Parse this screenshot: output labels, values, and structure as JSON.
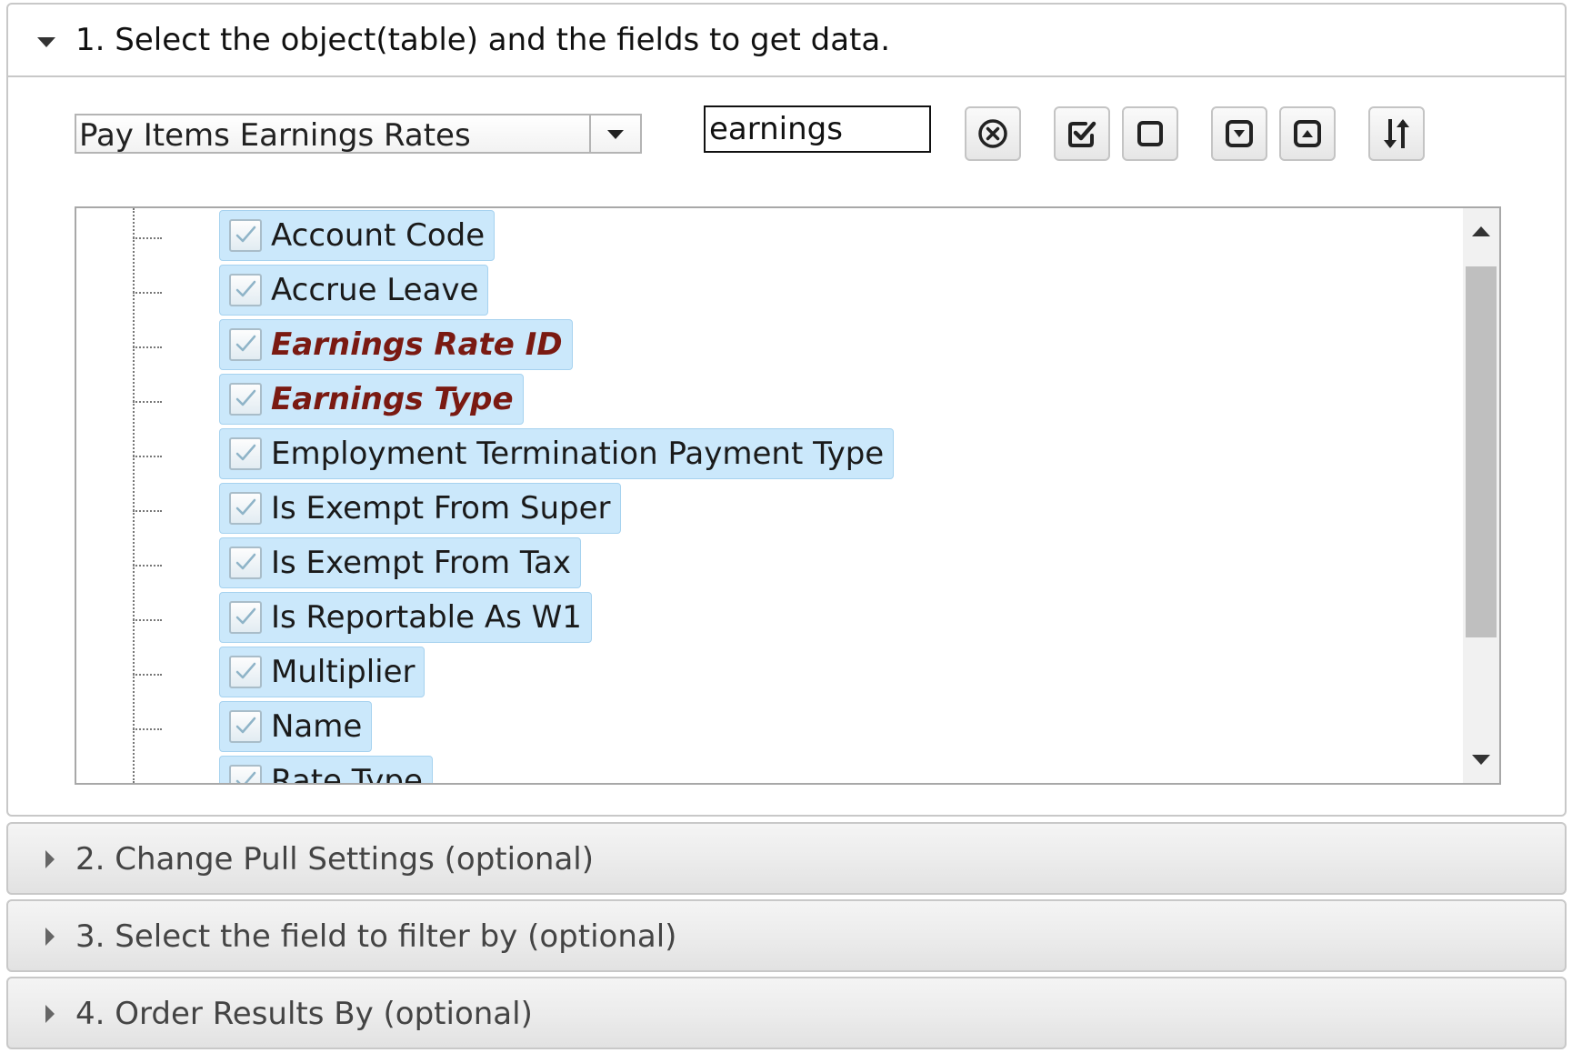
{
  "sections": [
    {
      "number": "1.",
      "title": "Select the object(table) and the fields to get data.",
      "expanded": true
    },
    {
      "number": "2.",
      "title": "Change Pull Settings (optional)",
      "expanded": false
    },
    {
      "number": "3.",
      "title": "Select the field to filter by (optional)",
      "expanded": false
    },
    {
      "number": "4.",
      "title": "Order Results By (optional)",
      "expanded": false
    }
  ],
  "object_select": {
    "value": "Pay Items Earnings Rates"
  },
  "search": {
    "value": "earnings",
    "placeholder": ""
  },
  "toolbar": [
    {
      "icon": "clear-circle-x-icon"
    },
    {
      "icon": "check-all-icon"
    },
    {
      "icon": "uncheck-all-icon"
    },
    {
      "icon": "expand-down-icon"
    },
    {
      "icon": "collapse-up-icon"
    },
    {
      "icon": "sort-icon"
    }
  ],
  "fields": [
    {
      "label": "Account Code",
      "checked": true,
      "key": false
    },
    {
      "label": "Accrue Leave",
      "checked": true,
      "key": false
    },
    {
      "label": "Earnings Rate ID",
      "checked": true,
      "key": true
    },
    {
      "label": "Earnings Type",
      "checked": true,
      "key": true
    },
    {
      "label": "Employment Termination Payment Type",
      "checked": true,
      "key": false
    },
    {
      "label": "Is Exempt From Super",
      "checked": true,
      "key": false
    },
    {
      "label": "Is Exempt From Tax",
      "checked": true,
      "key": false
    },
    {
      "label": "Is Reportable As W1",
      "checked": true,
      "key": false
    },
    {
      "label": "Multiplier",
      "checked": true,
      "key": false
    },
    {
      "label": "Name",
      "checked": true,
      "key": false
    },
    {
      "label": "Rate Type",
      "checked": true,
      "key": false
    }
  ],
  "colors": {
    "selected_bg": "#cbe8fb",
    "key_field_text": "#7a1a12",
    "border": "#c8c8c8"
  }
}
